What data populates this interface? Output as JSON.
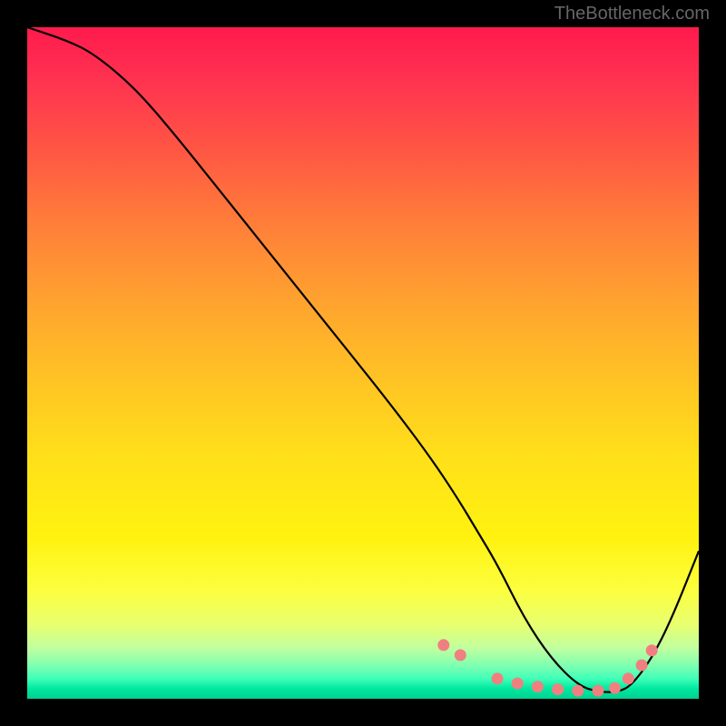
{
  "watermark": "TheBottleneck.com",
  "chart_data": {
    "type": "line",
    "title": "",
    "xlabel": "",
    "ylabel": "",
    "xlim": [
      0,
      100
    ],
    "ylim": [
      0,
      100
    ],
    "series": [
      {
        "name": "bottleneck-curve",
        "x": [
          0,
          6,
          10,
          16,
          22,
          30,
          38,
          46,
          54,
          60,
          64,
          67,
          70,
          74,
          78,
          82,
          85,
          88,
          90,
          93,
          96,
          100
        ],
        "y": [
          100,
          98,
          96,
          91,
          84,
          74,
          64,
          54,
          44,
          36,
          30,
          25,
          20,
          12,
          6,
          2,
          1,
          1,
          2,
          6,
          12,
          22
        ]
      }
    ],
    "markers": {
      "name": "highlight-dots",
      "color": "#f08080",
      "x": [
        62,
        64.5,
        70,
        73,
        76,
        79,
        82,
        85,
        87.5,
        89.5,
        91.5,
        93
      ],
      "y": [
        8,
        6.5,
        3,
        2.3,
        1.8,
        1.4,
        1.2,
        1.2,
        1.6,
        3.0,
        5.0,
        7.2
      ]
    },
    "gradient_stops": [
      {
        "pos": 0,
        "color": "#ff1a4d"
      },
      {
        "pos": 0.5,
        "color": "#ffd020"
      },
      {
        "pos": 0.9,
        "color": "#f5ff60"
      },
      {
        "pos": 1.0,
        "color": "#00d090"
      }
    ]
  }
}
